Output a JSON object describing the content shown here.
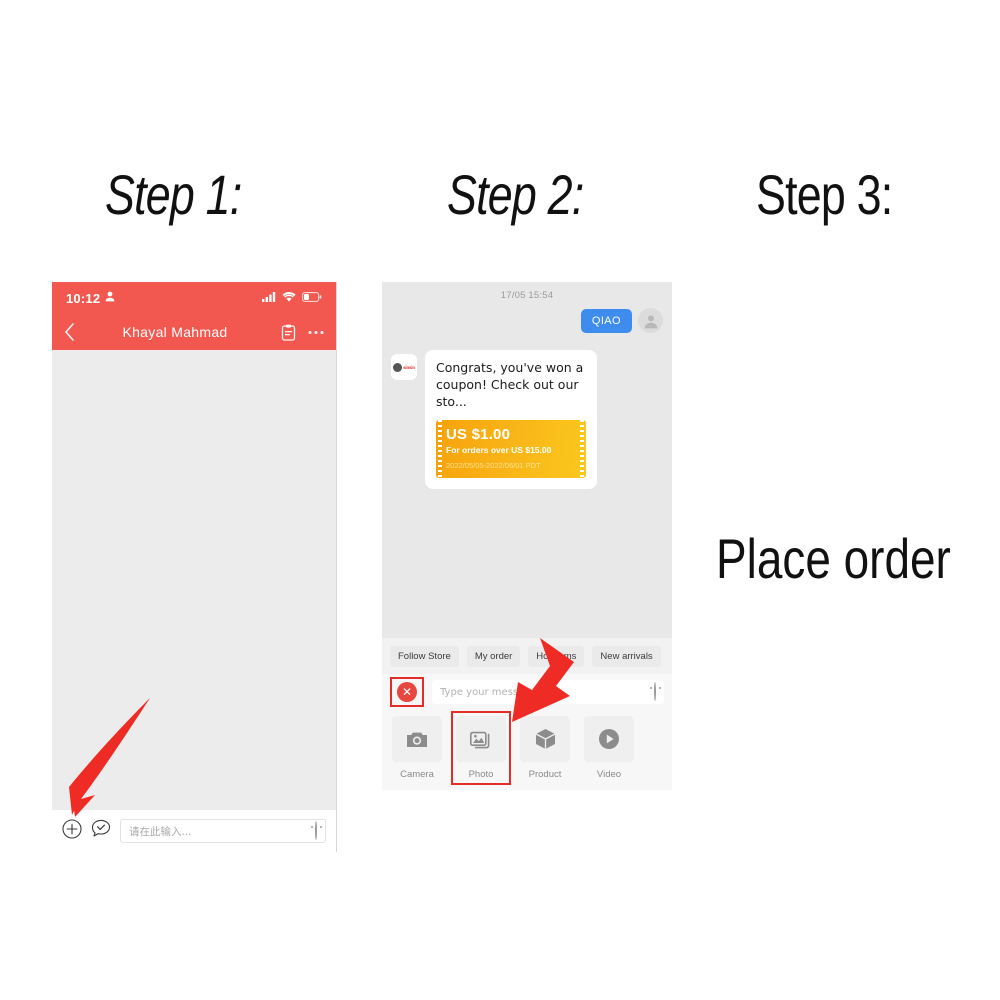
{
  "headings": {
    "step1": "Step 1:",
    "step2": "Step 2:",
    "step3": "Step 3:",
    "step3_body": "Place order"
  },
  "phone1": {
    "status": {
      "time": "10:12",
      "person_icon": "person-icon",
      "signal_icon": "signal-bars-icon",
      "wifi_icon": "wifi-icon",
      "battery_icon": "battery-low-icon"
    },
    "nav": {
      "back_icon": "chevron-left-icon",
      "title": "Khayal Mahmad",
      "order_icon": "clipboard-order-icon",
      "more_icon": "ellipsis-icon"
    },
    "input": {
      "plus_icon": "plus-circle-icon",
      "quick_reply_icon": "quick-reply-icon",
      "placeholder": "请在此输入...",
      "emoji_icon": "smiley-icon"
    }
  },
  "phone2": {
    "chat": {
      "timestamp": "17/05 15:54",
      "outgoing_message": "QIAO",
      "avatar_icon": "user-avatar-icon",
      "store_logo_text": "sinsin",
      "incoming_message": "Congrats, you've won a coupon! Check out our sto...",
      "coupon": {
        "amount": "US $1.00",
        "condition": "For orders over US $15.00",
        "validity": "2022/05/05-2022/06/01 PDT"
      }
    },
    "tabs": [
      "Follow Store",
      "My order",
      "Hot items",
      "New arrivals"
    ],
    "input": {
      "close_icon": "close-circle-icon",
      "placeholder": "Type your message...",
      "emoji_icon": "smiley-icon"
    },
    "actions": [
      {
        "label": "Camera",
        "icon": "camera-icon",
        "highlighted": false
      },
      {
        "label": "Photo",
        "icon": "photo-icon",
        "highlighted": true
      },
      {
        "label": "Product",
        "icon": "product-box-icon",
        "highlighted": false
      },
      {
        "label": "Video",
        "icon": "video-play-icon",
        "highlighted": false
      }
    ]
  },
  "annotations": {
    "arrow1": "red-arrow-pointing-to-plus-button",
    "arrow2": "red-arrow-pointing-to-photo-button"
  },
  "colors": {
    "header_red": "#f2584f",
    "accent_red": "#e52b27",
    "bubble_blue": "#3e8ced",
    "coupon_orange": "#f6a20b"
  }
}
